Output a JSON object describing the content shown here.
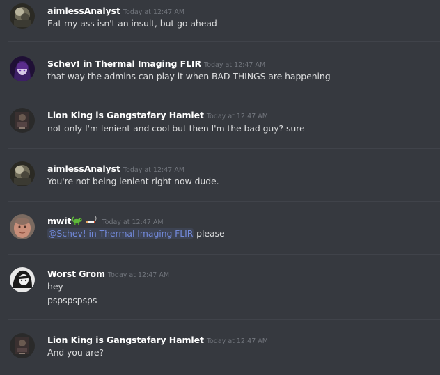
{
  "messages": [
    {
      "username": "aimlessAnalyst",
      "timestamp": "Today at 12:47 AM",
      "lines": [
        "Eat my ass isn't an insult, but go ahead"
      ]
    },
    {
      "username": "Schev! in Thermal Imaging FLIR",
      "timestamp": "Today at 12:47 AM",
      "lines": [
        "that way the admins can play it when BAD THINGS are happening"
      ]
    },
    {
      "username": "Lion King is Gangstafary Hamlet",
      "timestamp": "Today at 12:47 AM",
      "lines": [
        "not only I'm lenient and cool but then I'm the bad guy? sure"
      ]
    },
    {
      "username": "aimlessAnalyst",
      "timestamp": "Today at 12:47 AM",
      "lines": [
        "You're not being lenient right now dude."
      ]
    },
    {
      "username": "mwit",
      "timestamp": "Today at 12:47 AM",
      "mention": "@Schev! in Thermal Imaging FLIR",
      "after_mention": " please",
      "badges": [
        "lizard-emoji-icon",
        "cigarette-emoji-icon"
      ]
    },
    {
      "username": "Worst Grom",
      "timestamp": "Today at 12:47 AM",
      "lines": [
        "hey",
        "pspspspsps"
      ]
    },
    {
      "username": "Lion King is Gangstafary Hamlet",
      "timestamp": "Today at 12:47 AM",
      "lines": [
        "And you are?"
      ]
    }
  ],
  "colors": {
    "background": "#36393f",
    "username": "#ffffff",
    "timestamp": "#72767d",
    "text": "#dcddde",
    "mention": "#7289da",
    "divider": "#40434a"
  }
}
